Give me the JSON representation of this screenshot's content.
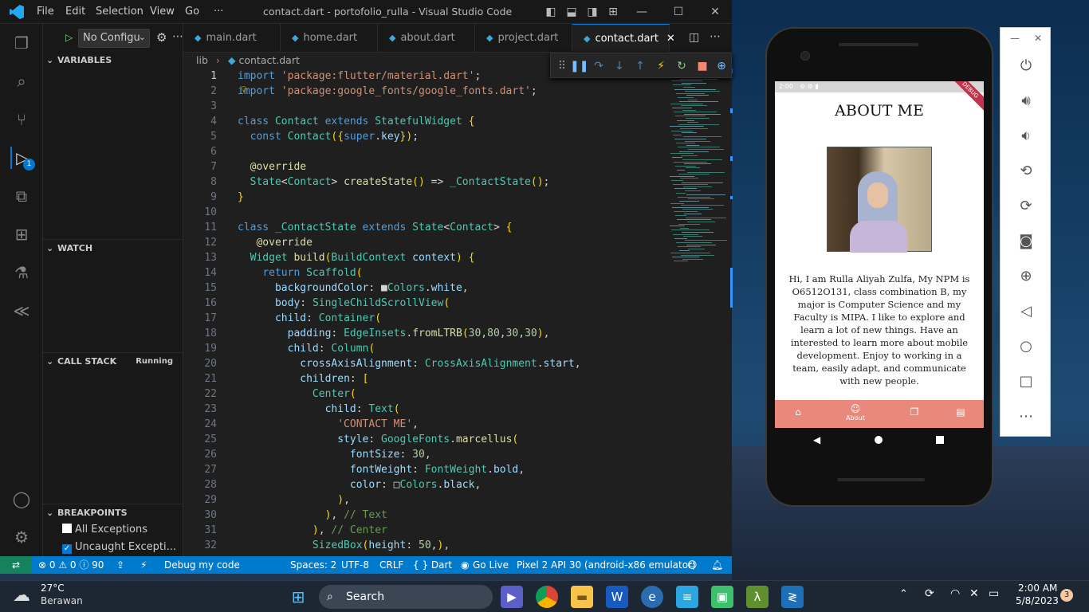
{
  "titlebar": {
    "menus": [
      "File",
      "Edit",
      "Selection",
      "View",
      "Go",
      "···"
    ],
    "title": "contact.dart - portofolio_rulla - Visual Studio Code"
  },
  "sidebar": {
    "debug_config": "No Configu",
    "sections": {
      "variables": "VARIABLES",
      "watch": "WATCH",
      "call_stack": "CALL STACK",
      "call_stack_status": "Running",
      "breakpoints": "BREAKPOINTS"
    },
    "breakpoints": [
      {
        "label": "All Exceptions",
        "checked": false
      },
      {
        "label": "Uncaught Excepti...",
        "checked": true
      }
    ],
    "debug_badge": "1"
  },
  "tabs": [
    "main.dart",
    "home.dart",
    "about.dart",
    "project.dart",
    "contact.dart"
  ],
  "breadcrumb": {
    "folder": "lib",
    "file": "contact.dart"
  },
  "editor": {
    "lines": [
      {
        "n": "1",
        "text": "import 'package:flutter/material.dart';"
      },
      {
        "n": "2",
        "text": "import 'package:google_fonts/google_fonts.dart';"
      },
      {
        "n": "3",
        "text": ""
      },
      {
        "n": "4",
        "text": "class Contact extends StatefulWidget {"
      },
      {
        "n": "5",
        "text": "  const Contact({super.key});"
      },
      {
        "n": "6",
        "text": ""
      },
      {
        "n": "7",
        "text": "  @override"
      },
      {
        "n": "8",
        "text": "  State<Contact> createState() => _ContactState();"
      },
      {
        "n": "9",
        "text": "}"
      },
      {
        "n": "10",
        "text": ""
      },
      {
        "n": "11",
        "text": "class _ContactState extends State<Contact> {"
      },
      {
        "n": "12",
        "text": "   @override"
      },
      {
        "n": "13",
        "text": "  Widget build(BuildContext context) {"
      },
      {
        "n": "14",
        "text": "    return Scaffold("
      },
      {
        "n": "15",
        "text": "      backgroundColor: ■Colors.white,"
      },
      {
        "n": "16",
        "text": "      body: SingleChildScrollView("
      },
      {
        "n": "17",
        "text": "      child: Container("
      },
      {
        "n": "18",
        "text": "        padding: EdgeInsets.fromLTRB(30,80,30,30),"
      },
      {
        "n": "19",
        "text": "        child: Column("
      },
      {
        "n": "20",
        "text": "          crossAxisAlignment: CrossAxisAlignment.start,"
      },
      {
        "n": "21",
        "text": "          children: ["
      },
      {
        "n": "22",
        "text": "            Center("
      },
      {
        "n": "23",
        "text": "              child: Text("
      },
      {
        "n": "24",
        "text": "                'CONTACT ME',"
      },
      {
        "n": "25",
        "text": "                style: GoogleFonts.marcellus("
      },
      {
        "n": "26",
        "text": "                  fontSize: 30,"
      },
      {
        "n": "27",
        "text": "                  fontWeight: FontWeight.bold,"
      },
      {
        "n": "28",
        "text": "                  color: □Colors.black,"
      },
      {
        "n": "29",
        "text": "                ),"
      },
      {
        "n": "30",
        "text": "              ), // Text"
      },
      {
        "n": "31",
        "text": "            ), // Center"
      },
      {
        "n": "32",
        "text": "            SizedBox(height: 50,),"
      }
    ]
  },
  "statusbar": {
    "problems": "⊗ 0 ⚠ 0 ⓘ 90",
    "debug": "Debug my code",
    "spaces": "Spaces: 2",
    "encoding": "UTF-8",
    "eol": "CRLF",
    "language": "{ } Dart",
    "golive": "Go Live",
    "device": "Pixel 2 API 30 (android-x86 emulator)"
  },
  "phone": {
    "status_time": "2:00",
    "ribbon": "DEBUG",
    "title": "ABOUT ME",
    "bio": "Hi, I am Rulla Aliyah Zulfa, My NPM is O6512O131, class combination B, my major is Computer Science and my Faculty is MIPA. I like to explore and learn a lot of new things. Have an interested to learn more about mobile development. Enjoy to working in a team, easily adapt, and communicate with new people.",
    "nav_label": "About"
  },
  "taskbar": {
    "weather_temp": "27°C",
    "weather_desc": "Berawan",
    "search": "Search",
    "time": "2:00 AM",
    "date": "5/8/2023",
    "notif_count": "3"
  }
}
